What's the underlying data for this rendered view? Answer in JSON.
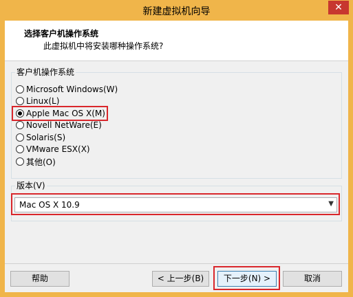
{
  "window": {
    "title": "新建虚拟机向导",
    "close_icon": "✕"
  },
  "header": {
    "title": "选择客户机操作系统",
    "subtitle": "此虚拟机中将安装哪种操作系统?"
  },
  "os_group": {
    "label": "客户机操作系统",
    "options": [
      {
        "label": "Microsoft Windows(W)",
        "checked": false
      },
      {
        "label": "Linux(L)",
        "checked": false
      },
      {
        "label": "Apple Mac OS X(M)",
        "checked": true
      },
      {
        "label": "Novell NetWare(E)",
        "checked": false
      },
      {
        "label": "Solaris(S)",
        "checked": false
      },
      {
        "label": "VMware ESX(X)",
        "checked": false
      },
      {
        "label": "其他(O)",
        "checked": false
      }
    ]
  },
  "version_group": {
    "label": "版本(V)",
    "selected": "Mac OS X 10.9"
  },
  "buttons": {
    "help": "帮助",
    "back": "< 上一步(B)",
    "next": "下一步(N) >",
    "cancel": "取消"
  },
  "colors": {
    "title_bar": "#f0b54a",
    "close_button": "#c7372f",
    "highlight_border": "#d9262b"
  }
}
